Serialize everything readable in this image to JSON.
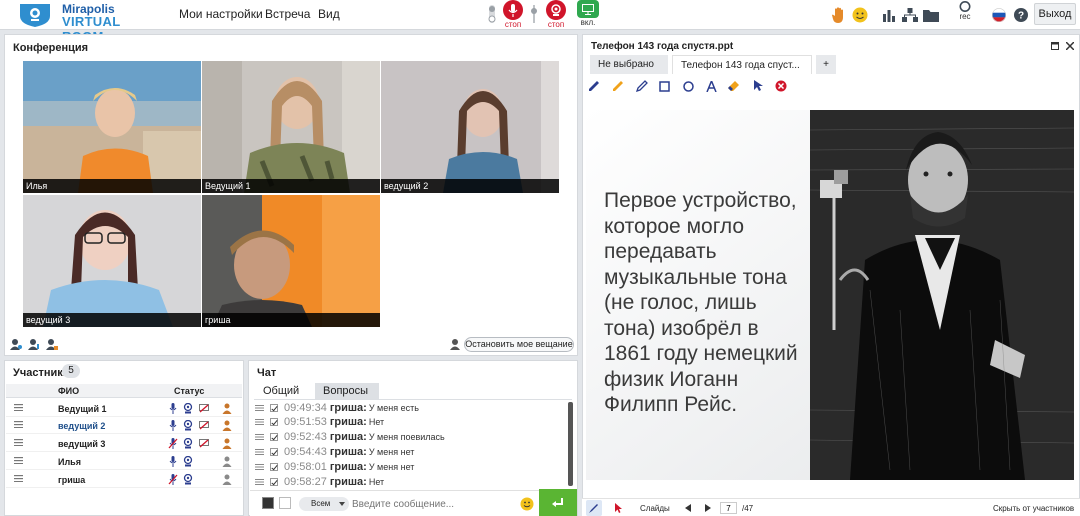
{
  "app": {
    "logo_line1": "Mirapolis",
    "logo_line2": "VIRTUAL ROOM"
  },
  "menu": [
    "Мои настройки",
    "Встреча",
    "Вид"
  ],
  "media": {
    "mic_label": "стоп",
    "cam_label": "стоп",
    "screen_label": "вкл."
  },
  "top_right": {
    "rec_label": "rec",
    "exit_label": "Выход"
  },
  "conference": {
    "title": "Конференция",
    "tiles": [
      "Илья",
      "Ведущий 1",
      "ведущий 2",
      "ведущий 3",
      "гриша"
    ],
    "stop_broadcast": "Остановить мое вещание"
  },
  "participants": {
    "title": "Участники",
    "count": "5",
    "col_name": "ФИО",
    "col_status": "Статус",
    "rows": [
      {
        "name": "Ведущий 1",
        "color": "#222222"
      },
      {
        "name": "ведущий 2",
        "color": "#1f4f8a"
      },
      {
        "name": "ведущий 3",
        "color": "#222222"
      },
      {
        "name": "Илья",
        "color": "#222222"
      },
      {
        "name": "гриша",
        "color": "#222222"
      }
    ]
  },
  "chat": {
    "title": "Чат",
    "tabs": [
      "Общий",
      "Вопросы"
    ],
    "messages": [
      {
        "time": "09:49:34",
        "author": "гриша:",
        "text": "У меня есть"
      },
      {
        "time": "09:51:53",
        "author": "гриша:",
        "text": "Нет"
      },
      {
        "time": "09:52:43",
        "author": "гриша:",
        "text": "У меня поевилась"
      },
      {
        "time": "09:54:43",
        "author": "гриша:",
        "text": "У меня нет"
      },
      {
        "time": "09:58:01",
        "author": "гриша:",
        "text": "У меня нет"
      },
      {
        "time": "09:58:27",
        "author": "гриша:",
        "text": "Нет"
      }
    ],
    "recipient": "Всем",
    "input_placeholder": "Введите сообщение..."
  },
  "presentation": {
    "title": "Телефон 143 года спустя.ppt",
    "tabs": [
      "Не выбрано",
      "Телефон 143 года спуст..."
    ],
    "add_tab": "+",
    "slide_text": "Первое устройство, которое могло передавать музыкальные тона (не голос, лишь тона) изобрёл в 1861 году немецкий физик Иоганн Филипп Рейс.",
    "slides_label": "Слайды",
    "current_page": "7",
    "total_pages": "/47",
    "hide_label": "Скрыть от участников"
  },
  "colors": {
    "accent_blue": "#2f8ecf",
    "record_red": "#d0152a",
    "screen_green": "#2fa84f",
    "send_green": "#5ab533"
  }
}
